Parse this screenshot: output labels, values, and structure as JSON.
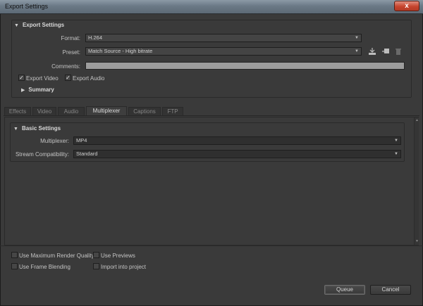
{
  "window": {
    "title": "Export Settings",
    "close_label": "x"
  },
  "export_settings": {
    "heading": "Export Settings",
    "format_label": "Format:",
    "format_value": "H.264",
    "preset_label": "Preset:",
    "preset_value": "Match Source - High bitrate",
    "comments_label": "Comments:",
    "comments_value": "",
    "export_video_label": "Export Video",
    "export_video_checked": true,
    "export_audio_label": "Export Audio",
    "export_audio_checked": true,
    "summary_label": "Summary",
    "icons": [
      "save-preset-icon",
      "import-preset-icon",
      "delete-preset-icon"
    ]
  },
  "tabs": [
    {
      "label": "Effects",
      "active": false
    },
    {
      "label": "Video",
      "active": false
    },
    {
      "label": "Audio",
      "active": false
    },
    {
      "label": "Multiplexer",
      "active": true
    },
    {
      "label": "Captions",
      "active": false
    },
    {
      "label": "FTP",
      "active": false
    }
  ],
  "basic_settings": {
    "heading": "Basic Settings",
    "multiplexer_label": "Multiplexer:",
    "multiplexer_value": "MP4",
    "stream_label": "Stream Compatibility:",
    "stream_value": "Standard"
  },
  "options": {
    "max_render_quality": "Use Maximum Render Quality",
    "use_previews": "Use Previews",
    "frame_blending": "Use Frame Blending",
    "import_into_project": "Import into project"
  },
  "buttons": {
    "queue": "Queue",
    "cancel": "Cancel"
  }
}
